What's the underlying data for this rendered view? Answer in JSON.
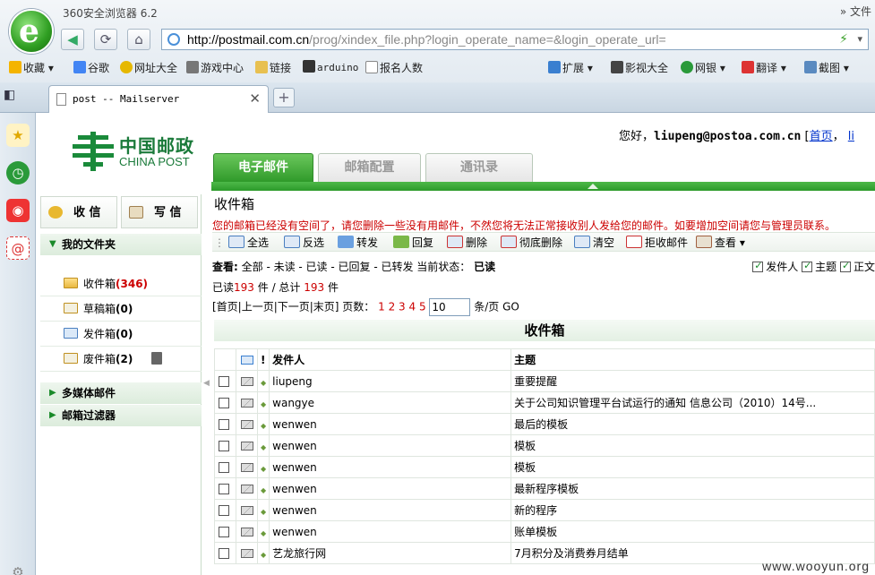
{
  "browser": {
    "window_title": "360安全浏览器 6.2",
    "window_right": "文件",
    "url_host": "http://postmail.com.cn",
    "url_path": "/prog/xindex_file.php?login_operate_name=&login_operate_url=",
    "bookmarks": [
      "收藏",
      "谷歌",
      "网址大全",
      "游戏中心",
      "链接",
      "arduino",
      "报名人数"
    ],
    "bookmarks_right": [
      "扩展",
      "影视大全",
      "网银",
      "翻译",
      "截图"
    ],
    "tab_title": "post -- Mailserver",
    "new_tab": "+"
  },
  "header": {
    "brand_cn": "中国邮政",
    "brand_en": "CHINA POST",
    "greeting": "您好，",
    "user": "liupeng@postoa.com.cn",
    "home_link": "首页",
    "trailing": "li"
  },
  "main_tabs": [
    {
      "label": "电子邮件",
      "active": true
    },
    {
      "label": "邮箱配置",
      "active": false
    },
    {
      "label": "通讯录",
      "active": false
    }
  ],
  "left_panel": {
    "receive": "收 信",
    "write": "写 信",
    "my_folders": "我的文件夹",
    "folders": [
      {
        "name": "收件箱",
        "count": "(346)"
      },
      {
        "name": "草稿箱",
        "count": "(0)"
      },
      {
        "name": "发件箱",
        "count": "(0)"
      },
      {
        "name": "废件箱",
        "count": "(2)"
      }
    ],
    "multimedia": "多媒体邮件",
    "filters": "邮箱过滤器"
  },
  "inbox": {
    "title": "收件箱",
    "warning": "您的邮箱已经没有空间了，请您删除一些没有用邮件，不然您将无法正常接收别人发给您的邮件。如要增加空间请您与管理员联系。",
    "toolbar": [
      "全选",
      "反选",
      "转发",
      "回复",
      "删除",
      "彻底删除",
      "清空",
      "拒收邮件",
      "查看"
    ],
    "filter_label": "查看:",
    "filter_options": "全部 - 未读 - 已读 - 已回复 - 已转发 当前状态：",
    "filter_current": "已读",
    "show_cols": [
      "发件人",
      "主题",
      "正文"
    ],
    "read_label": "已读",
    "read_count": "193",
    "total_label": "件 / 总计",
    "total_count": "193",
    "unit": "件",
    "pager_nav": "[首页|上一页|下一页|末页] 页数：",
    "pages": "1 2 3 4 5",
    "page_size": "10",
    "per_page": "条/页 GO",
    "list_title": "收件箱",
    "columns": {
      "from": "发件人",
      "subject": "主题"
    },
    "mails": [
      {
        "from": "liupeng",
        "subject": "重要提醒"
      },
      {
        "from": "wangye",
        "subject": "关于公司知识管理平台试运行的通知 信息公司（2010）14号..."
      },
      {
        "from": "wenwen",
        "subject": "最后的模板"
      },
      {
        "from": "wenwen",
        "subject": "模板"
      },
      {
        "from": "wenwen",
        "subject": "模板"
      },
      {
        "from": "wenwen",
        "subject": "最新程序模板"
      },
      {
        "from": "wenwen",
        "subject": "新的程序"
      },
      {
        "from": "wenwen",
        "subject": "账单模板"
      },
      {
        "from": "艺龙旅行网",
        "subject": "7月积分及消费券月结单"
      }
    ]
  },
  "watermark": "www.wooyun.org"
}
